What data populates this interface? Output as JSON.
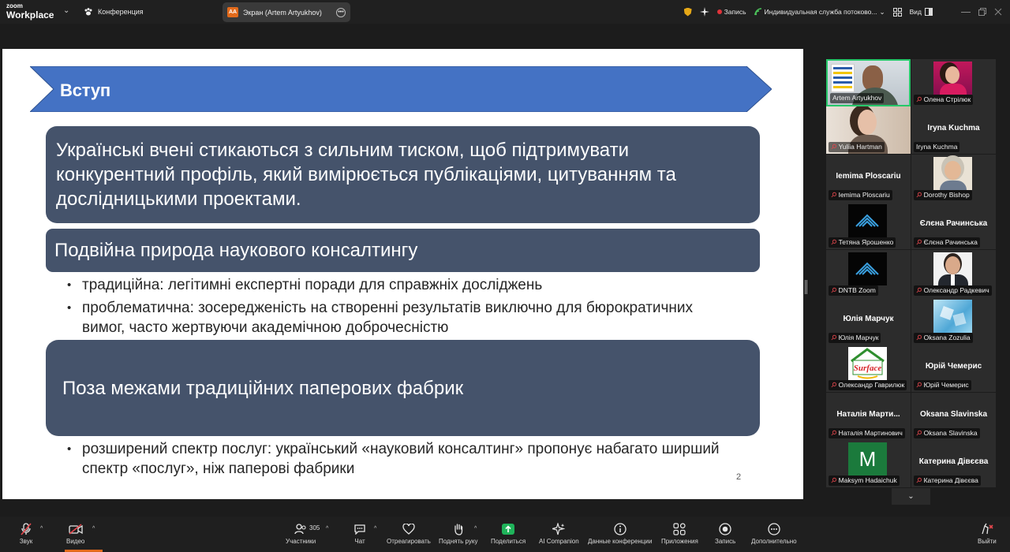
{
  "app": {
    "brand_small": "zoom",
    "brand_big": "Workplace",
    "meeting_tab": "Конференция",
    "screen_tab_badge": "AA",
    "screen_tab": "Экран (Artem Artyukhov)",
    "recording": "Запись",
    "stream": "Индивидуальная служба потоково...",
    "view": "Вид"
  },
  "slide": {
    "banner_title": "Вступ",
    "box1_text": "Українські вчені стикаються з сильним тиском, щоб підтримувати конкурентний профіль, який вимірюється публікаціями, цитуванням та дослідницькими проектами.",
    "box2_text": "Подвійна природа наукового консалтингу",
    "bullets1": [
      "традиційна: легітимні експертні поради для справжніх досліджень",
      "проблематична: зосередженість на створенні результатів виключно для бюрократичних вимог, часто жертвуючи академічною доброчесністю"
    ],
    "box3_text": "Поза межами традиційних паперових фабрик",
    "bullets2": [
      " розширений спектр послуг: український «науковий консалтинг» пропонує набагато ширший спектр «послуг», ніж паперові фабрики"
    ],
    "page_number": "2",
    "colors": {
      "banner": "#4472c4",
      "box": "#45536b"
    }
  },
  "gallery": [
    {
      "label": "Artem Artyukhov",
      "center": "",
      "muted": false,
      "kind": "photo-artem"
    },
    {
      "label": "Олена Стрілюк",
      "center": "",
      "muted": true,
      "kind": "photo-olena"
    },
    {
      "label": "Yuliia Hartman",
      "center": "",
      "muted": true,
      "kind": "photo-yulia"
    },
    {
      "label": "Iryna Kuchma",
      "center": "Iryna Kuchma",
      "muted": false,
      "kind": "name"
    },
    {
      "label": "Iemima Ploscariu",
      "center": "Iemima Ploscariu",
      "muted": true,
      "kind": "name"
    },
    {
      "label": "Dorothy Bishop",
      "center": "",
      "muted": true,
      "kind": "photo-dorothy"
    },
    {
      "label": "Тетяна Ярошенко",
      "center": "",
      "muted": true,
      "kind": "logo-dntb"
    },
    {
      "label": "Єлєна Рачинська",
      "center": "Єлєна Рачинська",
      "muted": true,
      "kind": "name"
    },
    {
      "label": "DNTB Zoom",
      "center": "",
      "muted": true,
      "kind": "logo-dntb"
    },
    {
      "label": "Олександр Радкевич",
      "center": "",
      "muted": true,
      "kind": "photo-alex"
    },
    {
      "label": "Юлія Марчук",
      "center": "Юлія Марчук",
      "muted": true,
      "kind": "name"
    },
    {
      "label": "Oksana Zozulia",
      "center": "",
      "muted": true,
      "kind": "photo-ice"
    },
    {
      "label": "Олександр Гаврилюк",
      "center": "",
      "muted": true,
      "kind": "logo-surface"
    },
    {
      "label": "Юрій Чемерис",
      "center": "Юрій Чемерис",
      "muted": true,
      "kind": "name"
    },
    {
      "label": "Наталія Мартинович",
      "center": "Наталія  Марти...",
      "muted": true,
      "kind": "name"
    },
    {
      "label": "Oksana Slavinska",
      "center": "Oksana Slavinska",
      "muted": true,
      "kind": "name"
    },
    {
      "label": "Maksym Hadaichuk",
      "center": "",
      "muted": true,
      "kind": "avatar-m",
      "initial": "M"
    },
    {
      "label": "Катерина Дівєєва",
      "center": "Катерина Дівєєва",
      "muted": true,
      "kind": "name"
    }
  ],
  "surface_logo_text": "Surface",
  "toolbar": {
    "audio": "Звук",
    "video": "Видео",
    "participants": "Участники",
    "participants_count": "305",
    "chat": "Чат",
    "react": "Отреагировать",
    "raise_hand": "Поднять руку",
    "share": "Поделиться",
    "ai": "AI Companion",
    "meeting_data": "Данные конференции",
    "apps": "Приложения",
    "record": "Запись",
    "more": "Дополнительно",
    "leave": "Выйти"
  }
}
